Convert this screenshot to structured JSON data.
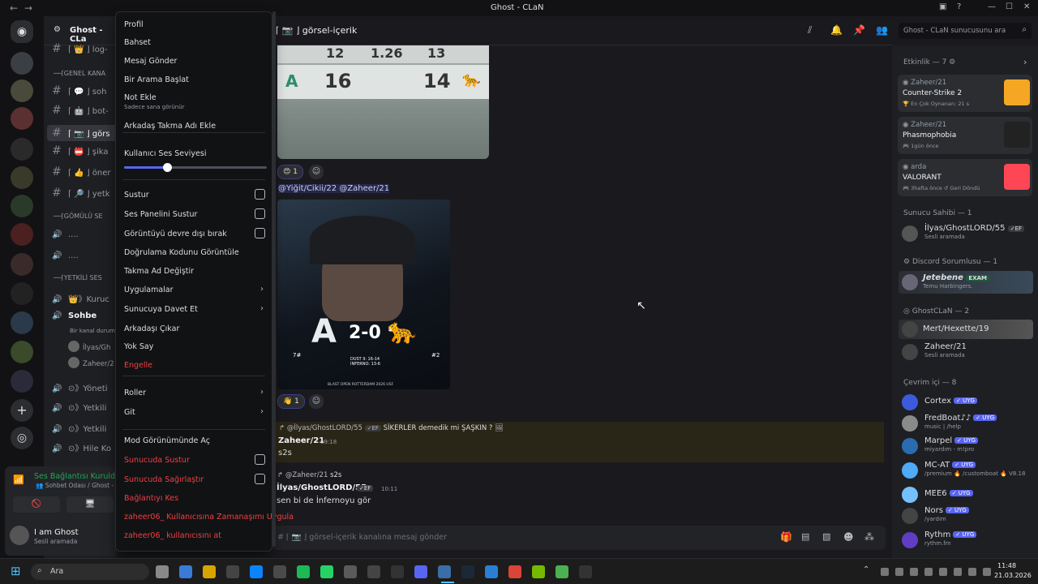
{
  "window": {
    "title": "Ghost - CLaN"
  },
  "server": {
    "name": "Ghost - CLa"
  },
  "header": {
    "channel": "⌈ 📷 ⌋ görsel-içerik",
    "search_placeholder": "Ghost - CLaN sunucusunu ara"
  },
  "channels": [
    {
      "label": "⌈ 👑 ⌋ log-",
      "icon": "#"
    },
    {
      "label": "──⌈GENEL KANA",
      "cat": true
    },
    {
      "label": "⌈ 💬 ⌋ soh",
      "icon": "#"
    },
    {
      "label": "⌈ 🤖 ⌋ bot-",
      "icon": "#"
    },
    {
      "label": "⌈ 📷 ⌋ görs",
      "icon": "#",
      "active": true
    },
    {
      "label": "⌈ 📛 ⌋ şika",
      "icon": "#"
    },
    {
      "label": "⌈ 👍 ⌋ öner",
      "icon": "#"
    },
    {
      "label": "⌈ 🔎 ⌋ yetk",
      "icon": "#"
    },
    {
      "label": "──⌈GÖMÜLÜ SE",
      "cat": true
    },
    {
      "label": "....",
      "icon": "🔊"
    },
    {
      "label": "....",
      "icon": "🔊"
    },
    {
      "label": "──⌈YETKİLİ SES",
      "cat": true
    },
    {
      "label": "👑》Kuruc",
      "icon": "🔊"
    },
    {
      "label": "Sohbe",
      "icon": "🔊",
      "active_voice": true
    },
    {
      "label": "Bir kanal durumu",
      "sub": true
    },
    {
      "label": "İlyas/Gh",
      "user": true
    },
    {
      "label": "Zaheer/2",
      "user": true
    },
    {
      "label": "⊙》Yöneti",
      "icon": "🔊"
    },
    {
      "label": "⊙》Yetkili",
      "icon": "🔊"
    },
    {
      "label": "⊙》Yetkili",
      "icon": "🔊"
    },
    {
      "label": "⊙》Hile Ko",
      "icon": "🔊"
    }
  ],
  "voice_status": {
    "title": "Ses Bağlantısı Kuruldu",
    "sub": "👥 Sohbet Odası / Ghost -"
  },
  "user_panel": {
    "name": "I am Ghost",
    "status": "Sesli aramada"
  },
  "context_menu": [
    {
      "label": "Profil"
    },
    {
      "label": "Bahset"
    },
    {
      "label": "Mesaj Gönder"
    },
    {
      "label": "Bir Arama Başlat"
    },
    {
      "label": "Not Ekle",
      "sub": "Sadece sana görünür"
    },
    {
      "label": "Arkadaş Takma Adı Ekle"
    },
    {
      "label": "Kullanıcı Ses Seviyesi"
    },
    {
      "label": "Sustur",
      "check": true
    },
    {
      "label": "Ses Panelini Sustur",
      "check": true
    },
    {
      "label": "Görüntüyü devre dışı bırak",
      "check": true
    },
    {
      "label": "Doğrulama Kodunu Görüntüle"
    },
    {
      "label": "Takma Ad Değiştir"
    },
    {
      "label": "Uygulamalar",
      "arrow": true
    },
    {
      "label": "Sunucuya Davet Et",
      "arrow": true
    },
    {
      "label": "Arkadaşı Çıkar"
    },
    {
      "label": "Yok Say"
    },
    {
      "label": "Engelle",
      "red": true
    },
    {
      "label": "Roller",
      "arrow": true
    },
    {
      "label": "Git",
      "arrow": true
    },
    {
      "label": "Mod Görünümünde Aç"
    },
    {
      "label": "Sunucuda Sustur",
      "red": true,
      "check": true
    },
    {
      "label": "Sunucuda Sağırlaştır",
      "red": true,
      "check": true
    },
    {
      "label": "Bağlantıyı Kes",
      "red": true
    },
    {
      "label": "zaheer06_ Kullanıcısına Zamanaşımı Uygula",
      "red": true
    },
    {
      "label": "zaheer06_ kullanıcısını at",
      "red": true
    }
  ],
  "volume": {
    "level": 0.3
  },
  "chat": {
    "scoreboard": {
      "top": [
        "12",
        "1.26",
        "13"
      ],
      "bottom_left": "16",
      "bottom_right": "14"
    },
    "reaction1": {
      "emoji": "😍",
      "count": "1"
    },
    "mentions": "@Yiğit/Cikii/22 @Zaheer/21",
    "image2": {
      "score": "2-0",
      "left": "7#",
      "right": "#2",
      "lines": "DUST II: 16-14\nINFERNO: 13-6",
      "footer": "BLAST OPEN ROTTERDAM 2026 USF"
    },
    "reaction2": {
      "emoji": "👋",
      "count": "1"
    },
    "reply1": {
      "author": "@İlyas/GhostLORD/55",
      "tag": "✓EF",
      "text": "SİKERLER demedik mi ŞAŞKIN ?"
    },
    "msg1": {
      "author": "Zaheer/21",
      "time": "09:18",
      "text": "s2s"
    },
    "reply2": {
      "author": "@Zaheer/21",
      "text": "s2s"
    },
    "msg2": {
      "author": "İlyas/GhostLORD/55",
      "tag": "✓EF",
      "time": "10:11",
      "text": "sen bi de İnfernoyu gör"
    },
    "input_placeholder": "# ⌈ 📷 ⌋ görsel-içerik kanalına mesaj gönder"
  },
  "members": {
    "activity_header": "Etkinlik — 7",
    "activities": [
      {
        "user": "Zaheer/21",
        "game": "Counter-Strike 2",
        "sub": "🏆 En Çok Oynanan: 21 s"
      },
      {
        "user": "Zaheer/21",
        "game": "Phasmophobia",
        "sub": "🎮 1gün önce"
      },
      {
        "user": "arda",
        "game": "VALORANT",
        "sub": "🎮 3hafta önce  ↺ Geri Döndü"
      }
    ],
    "owner_header": "Sunucu Sahibi — 1",
    "owner": {
      "name": "İlyas/GhostLORD/55",
      "tag": "✓EF",
      "status": "Sesli aramada"
    },
    "discord_header": "Discord Sorumlusu — 1",
    "discord": {
      "name": "Jetebene",
      "tag": "EXAM",
      "status": "Temu Harbingers."
    },
    "clan_header": "GhostCLaN — 2",
    "clan": [
      {
        "name": "Mert/Hexette/19",
        "status": ""
      },
      {
        "name": "Zaheer/21",
        "status": "Sesli aramada"
      }
    ],
    "online_header": "Çevrim içi — 8",
    "online": [
      {
        "name": "Cortex",
        "status": "",
        "color": "#3b5bdb"
      },
      {
        "name": "FredBoat♪♪",
        "status": "music | /help",
        "color": "#8a8a8a"
      },
      {
        "name": "Marpel",
        "status": "miyardım - m!pro",
        "color": "#2b6cb0"
      },
      {
        "name": "MC-AT",
        "status": "/premium 🔥 /customboat 🔥 V8.18",
        "color": "#4dabf7"
      },
      {
        "name": "MEE6",
        "status": "",
        "color": "#74c0fc"
      },
      {
        "name": "Nors",
        "status": "/yardım",
        "color": "#444"
      },
      {
        "name": "Rythm",
        "status": "rythm.fm",
        "color": "#5f3dc4"
      }
    ],
    "bot_badge": "✓ UYG"
  },
  "taskbar": {
    "search": "Ara",
    "time": "11:48",
    "date": "21.03.2026"
  }
}
